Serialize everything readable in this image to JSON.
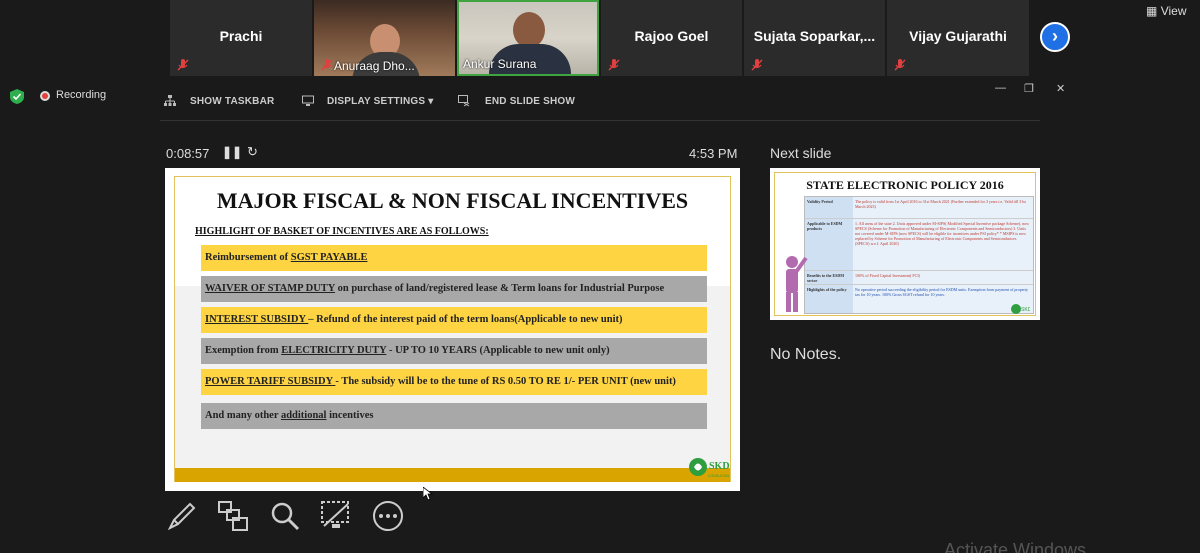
{
  "participants": [
    {
      "name": "Prachi",
      "type": "name-only"
    },
    {
      "name": "Anuraag Dho...",
      "type": "video"
    },
    {
      "name": "Ankur Surana",
      "type": "video",
      "active_speaker": true
    },
    {
      "name": "Rajoo Goel",
      "type": "name-only"
    },
    {
      "name": "Sujata  Soparkar,...",
      "type": "name-only"
    },
    {
      "name": "Vijay Gujarathi",
      "type": "name-only"
    }
  ],
  "view_button": {
    "label": "View",
    "icon": "grid-view-icon"
  },
  "next_participants_icon": "chevron-right-icon",
  "recording": {
    "label": "Recording",
    "color": "#e04040"
  },
  "security_icon": "shield-check-icon",
  "toolbar": {
    "show_taskbar": "SHOW TASKBAR",
    "display_settings": "DISPLAY SETTINGS",
    "end_slide_show": "END SLIDE SHOW"
  },
  "presenter": {
    "elapsed": "0:08:57",
    "clock": "4:53 PM",
    "next_slide_label": "Next slide",
    "notes": "No Notes."
  },
  "current_slide": {
    "title": "MAJOR FISCAL & NON FISCAL INCENTIVES",
    "subtitle": "HIGHLIGHT OF BASKET OF INCENTIVES ARE AS FOLLOWS:",
    "bars": [
      {
        "pre": "Reimbursement of ",
        "u": "SGST PAYABLE",
        "post": "",
        "color": "yellow"
      },
      {
        "pre": "",
        "u": "WAIVER OF STAMP DUTY",
        "post": " on purchase of land/registered lease & Term loans for Industrial Purpose",
        "color": "grey"
      },
      {
        "pre": "",
        "u": "INTEREST SUBSIDY ",
        "post": "– Refund of the interest paid of the term loans(Applicable to new unit)",
        "color": "yellow"
      },
      {
        "pre": " Exemption from ",
        "u": "ELECTRICITY DUTY",
        "post": " - UP TO 10 YEARS (Applicable to new unit only)",
        "color": "grey"
      },
      {
        "pre": "",
        "u": "POWER TARIFF SUBSIDY ",
        "post": "-  The subsidy will be to the tune of RS 0.50 TO  RE 1/- PER UNIT (new unit)",
        "color": "yellow"
      },
      {
        "pre": "And many other ",
        "u": "additional",
        "post": " incentives",
        "color": "grey"
      }
    ],
    "logo_text": "SKD",
    "logo_sub": "CONSULTANTS PVT. LTD."
  },
  "next_slide": {
    "title": "STATE ELECTRONIC POLICY 2016",
    "rows": [
      {
        "label": "Validity Period",
        "text": "The policy is valid from 1st April 2016 to 31st March 2021 (Further extended for 3 years i.e. Valid till 31st March 2023)"
      },
      {
        "label": "Applicable to ESDM products",
        "text": "1. All areas of the state  2. Units approved under M-SIPS( Modified Special Incentive package Scheme), now SPECS (Scheme for Promotion of Manufacturing of Electronic Components and Semiconductors)  3. Units not covered under M-SIPS (now SPECS) will be eligible for incentives under PSI policy*  * MSIPS is now replaced by Scheme for Promotion of Manufacturing of Electronic Components and Semiconductors (SPECS) w.e.f. April 2020)"
      },
      {
        "label": "Benefits to the ESDM sector",
        "text": "100% of Fixed Capital Investment( FCI)"
      },
      {
        "label": "Highlights of the policy",
        "text": "No operative period succeeding the eligibility period for ESDM units. Exemption from payment of property tax for 10 years. 100% Gross SGST refund for 10 years."
      }
    ]
  },
  "bottom_tools": [
    {
      "name": "pen-tool-icon"
    },
    {
      "name": "see-all-slides-icon"
    },
    {
      "name": "zoom-icon"
    },
    {
      "name": "black-screen-icon"
    },
    {
      "name": "more-options-icon"
    }
  ],
  "watermark": "Activate Windows"
}
